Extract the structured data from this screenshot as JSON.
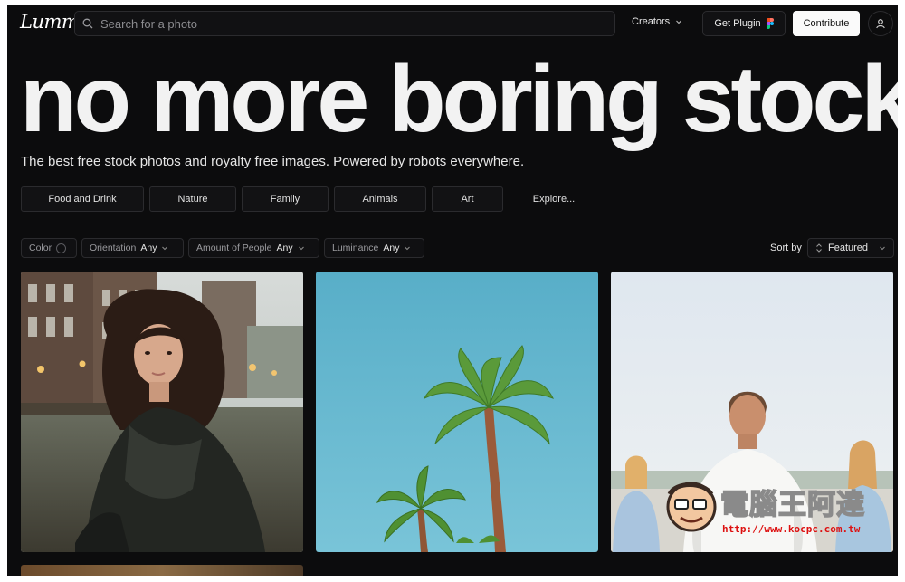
{
  "header": {
    "logo_text": "Lummi",
    "search_placeholder": "Search for a photo",
    "creators_label": "Creators",
    "plugin_label": "Get Plugin",
    "contribute_label": "Contribute"
  },
  "hero": {
    "headline": "no more boring stock",
    "subtitle": "The best free stock photos and royalty free images. Powered by robots everywhere."
  },
  "categories": [
    "Food and Drink",
    "Nature",
    "Family",
    "Animals",
    "Art",
    "Explore..."
  ],
  "filters": {
    "color_label": "Color",
    "orientation_label": "Orientation",
    "orientation_value": "Any",
    "people_label": "Amount of People",
    "people_value": "Any",
    "luminance_label": "Luminance",
    "luminance_value": "Any"
  },
  "sort": {
    "label": "Sort by",
    "value": "Featured"
  },
  "colors": {
    "background": "#0c0c0d",
    "border": "#2b2b2e",
    "text": "#f2f2f2",
    "contribute_bg": "#fafafa"
  },
  "photos": [
    {
      "name": "woman-in-city-photo"
    },
    {
      "name": "palm-trees-photo"
    },
    {
      "name": "yoga-people-photo"
    }
  ],
  "watermark": {
    "text": "電腦王阿達",
    "url": "http://www.kocpc.com.tw"
  }
}
